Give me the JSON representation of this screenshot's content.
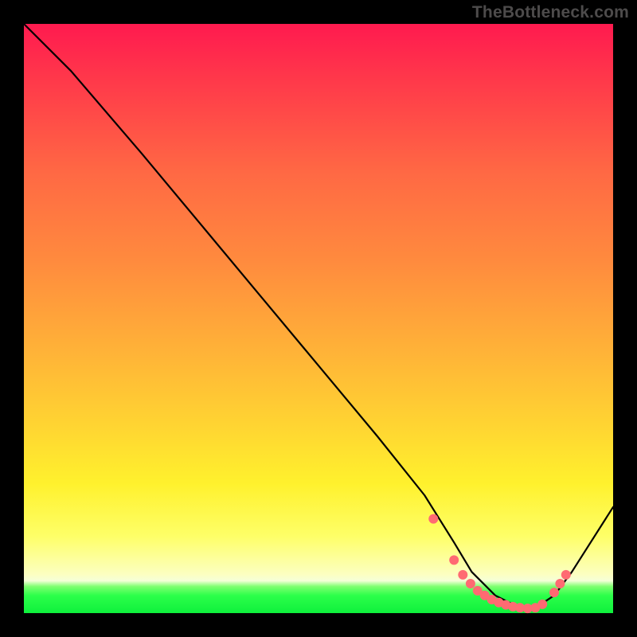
{
  "watermark": "TheBottleneck.com",
  "chart_data": {
    "type": "line",
    "title": "",
    "xlabel": "",
    "ylabel": "",
    "xlim": [
      0,
      100
    ],
    "ylim": [
      0,
      100
    ],
    "grid": false,
    "legend": false,
    "series": [
      {
        "name": "bottleneck-curve",
        "x": [
          0,
          8,
          20,
          30,
          40,
          50,
          60,
          68,
          73,
          76,
          80,
          84,
          87,
          90,
          93,
          100
        ],
        "values": [
          100,
          92,
          78,
          66,
          54,
          42,
          30,
          20,
          12,
          7,
          3,
          1,
          1,
          3,
          7,
          18
        ]
      }
    ],
    "markers": {
      "name": "optimal-zone-points",
      "x": [
        69.5,
        73.0,
        74.5,
        75.8,
        77.0,
        78.2,
        79.4,
        80.6,
        81.8,
        83.0,
        84.2,
        85.5,
        86.8,
        88.0,
        90.0,
        91.0,
        92.0
      ],
      "values": [
        16.0,
        9.0,
        6.5,
        5.0,
        3.8,
        3.0,
        2.3,
        1.8,
        1.4,
        1.1,
        0.9,
        0.8,
        0.9,
        1.5,
        3.5,
        5.0,
        6.5
      ]
    },
    "gradient_stops": [
      {
        "pos": 0,
        "color": "#ff1a4f"
      },
      {
        "pos": 10,
        "color": "#ff3a4a"
      },
      {
        "pos": 25,
        "color": "#ff6844"
      },
      {
        "pos": 40,
        "color": "#ff8a3e"
      },
      {
        "pos": 55,
        "color": "#ffb138"
      },
      {
        "pos": 68,
        "color": "#ffd432"
      },
      {
        "pos": 78,
        "color": "#fff12d"
      },
      {
        "pos": 87,
        "color": "#feff68"
      },
      {
        "pos": 93.5,
        "color": "#fcffc2"
      },
      {
        "pos": 94.5,
        "color": "#f5ffd8"
      },
      {
        "pos": 95.5,
        "color": "#7dff6f"
      },
      {
        "pos": 97,
        "color": "#2cff4a"
      },
      {
        "pos": 100,
        "color": "#0ef03c"
      }
    ]
  }
}
